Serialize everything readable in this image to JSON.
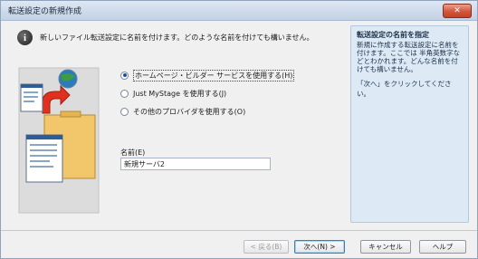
{
  "window": {
    "title": "転送設定の新規作成"
  },
  "info": {
    "text": "新しいファイル転送設定に名前を付けます。どのような名前を付けても構いません。"
  },
  "options": [
    {
      "label": "ホームページ・ビルダー サービスを使用する(H)",
      "checked": true
    },
    {
      "label": "Just MyStage を使用する(J)",
      "checked": false
    },
    {
      "label": "その他のプロバイダを使用する(O)",
      "checked": false
    }
  ],
  "name_field": {
    "label": "名前(E)",
    "value": "新規サーバ2"
  },
  "side_panel": {
    "title": "転送設定の名前を指定",
    "body": "新規に作成する転送設定に名前を付けます。ここでは 半角英数字などとわかれます。どんな名前を付けても構いません。",
    "hint": "「次へ」をクリックしてください。"
  },
  "buttons": {
    "back": "< 戻る(B)",
    "next": "次へ(N) >",
    "cancel": "キャンセル",
    "help": "ヘルプ"
  },
  "colors": {
    "accent": "#1f4fa0",
    "close": "#d3553b",
    "panel": "#ddeaf6"
  }
}
